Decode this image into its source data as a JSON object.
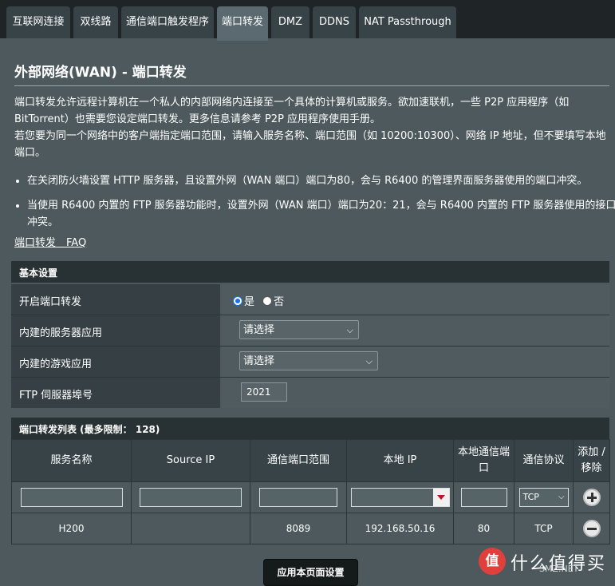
{
  "tabs": [
    {
      "label": "互联网连接",
      "active": false
    },
    {
      "label": "双线路",
      "active": false
    },
    {
      "label": "通信端口触发程序",
      "active": false
    },
    {
      "label": "端口转发",
      "active": true
    },
    {
      "label": "DMZ",
      "active": false
    },
    {
      "label": "DDNS",
      "active": false
    },
    {
      "label": "NAT Passthrough",
      "active": false
    }
  ],
  "page": {
    "title": "外部网络(WAN) - 端口转发",
    "intro_1": "端口转发允许远程计算机在一个私人的内部网络内连接至一个具体的计算机或服务。欲加速联机，一些 P2P 应用程序（如 BitTorrent）也需要您设定端口转发。更多信息请参考 P2P 应用程序使用手册。",
    "intro_2": "若您要为同一个网络中的客户端指定端口范围，请输入服务名称、端口范围（如 10200:10300）、网络 IP 地址，但不要填写本地端口。",
    "bullet_1": "在关闭防火墙设置 HTTP 服务器，且设置外网（WAN 端口）端口为80，会与 R6400 的管理界面服务器使用的端口冲突。",
    "bullet_2": "当使用 R6400 内置的 FTP 服务器功能时，设置外网（WAN 端口）端口为20：21，会与 R6400 内置的 FTP 服务器使用的接口冲突。",
    "faq_link": "端口转发　FAQ"
  },
  "basic": {
    "header": "基本设置",
    "enable_label": "开启端口转发",
    "yes_label": "是",
    "no_label": "否",
    "enable_value": "yes",
    "server_app_label": "内建的服务器应用",
    "server_app_value": "请选择",
    "game_app_label": "内建的游戏应用",
    "game_app_value": "请选择",
    "ftp_port_label": "FTP 伺服器埠号",
    "ftp_port_value": "2021"
  },
  "list": {
    "header": "端口转发列表 (最多限制： 128)",
    "columns": [
      "服务名称",
      "Source IP",
      "通信端口范围",
      "本地 IP",
      "本地通信端口",
      "通信协议",
      "添加 / 移除"
    ],
    "new_protocol": "TCP",
    "rows": [
      {
        "service": "H200",
        "source_ip": "",
        "port_range": "8089",
        "local_ip": "192.168.50.16",
        "local_port": "80",
        "protocol": "TCP"
      }
    ]
  },
  "apply_button": "应用本页面设置",
  "watermark": {
    "badge": "值",
    "text": "什么值得买",
    "sub": "SMZ.NET"
  }
}
